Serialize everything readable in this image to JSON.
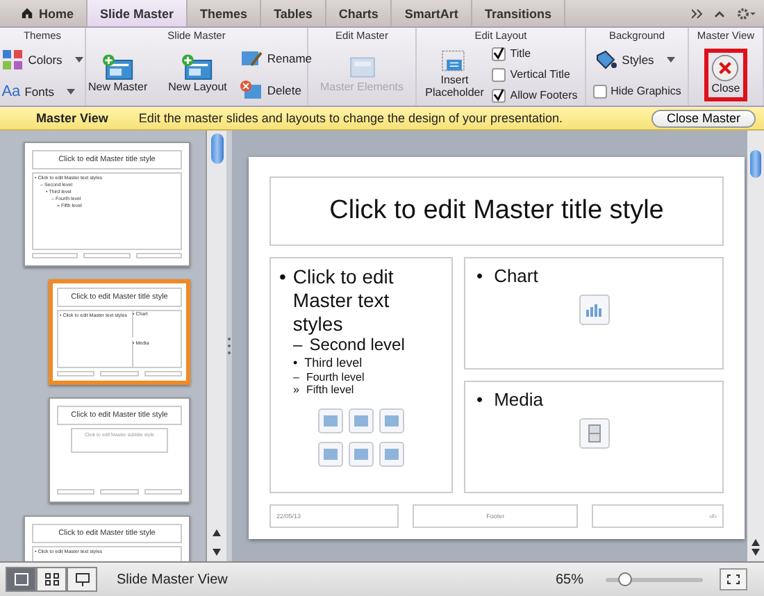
{
  "tabs": [
    {
      "label": "Home",
      "kind": "home",
      "selected": false
    },
    {
      "label": "Slide Master",
      "kind": "plain",
      "selected": true
    },
    {
      "label": "Themes",
      "kind": "plain",
      "selected": false
    },
    {
      "label": "Tables",
      "kind": "plain",
      "selected": false
    },
    {
      "label": "Charts",
      "kind": "plain",
      "selected": false
    },
    {
      "label": "SmartArt",
      "kind": "plain",
      "selected": false
    },
    {
      "label": "Transitions",
      "kind": "plain",
      "selected": false
    }
  ],
  "ribbon": [
    {
      "title": "Themes",
      "columns": [
        [
          {
            "kind": "dropdown",
            "label": "Colors"
          },
          {
            "kind": "dropdown",
            "label": "Fonts",
            "icon_text": "Aa"
          }
        ]
      ]
    },
    {
      "title": "Slide Master",
      "columns": [
        [
          {
            "kind": "large",
            "label": "New Master"
          }
        ],
        [
          {
            "kind": "large",
            "label": "New Layout"
          }
        ],
        [
          {
            "kind": "small",
            "label": "Rename"
          },
          {
            "kind": "small",
            "label": "Delete"
          }
        ]
      ]
    },
    {
      "title": "Edit Master",
      "columns": [
        [
          {
            "kind": "large",
            "label": "Master Elements",
            "disabled": true
          }
        ]
      ]
    },
    {
      "title": "Edit Layout",
      "columns": [
        [
          {
            "kind": "large",
            "label": "Insert Placeholder"
          }
        ],
        [
          {
            "kind": "check",
            "label": "Title",
            "checked": true
          },
          {
            "kind": "check",
            "label": "Vertical Title",
            "checked": false
          },
          {
            "kind": "check",
            "label": "Allow Footers",
            "checked": true
          }
        ]
      ]
    },
    {
      "title": "Background",
      "columns": [
        [
          {
            "kind": "dropdown",
            "label": "Styles"
          },
          {
            "kind": "check",
            "label": "Hide Graphics",
            "checked": false
          }
        ]
      ]
    },
    {
      "title": "Master View",
      "columns": [
        [
          {
            "kind": "large",
            "label": "Close",
            "highlighted": true
          }
        ]
      ]
    }
  ],
  "message_bar": {
    "title": "Master View",
    "text": "Edit the master slides and layouts to change the design of your presentation.",
    "button": "Close Master"
  },
  "thumbnails": [
    {
      "kind": "master",
      "selected": false,
      "title": "Click to edit Master title style",
      "body": [
        {
          "bullet": "•",
          "text": "Click to edit Master text styles",
          "children": [
            {
              "bullet": "–",
              "text": "Second level",
              "children": [
                {
                  "bullet": "•",
                  "text": "Third level",
                  "children": [
                    {
                      "bullet": "–",
                      "text": "Fourth level",
                      "children": [
                        {
                          "bullet": "»",
                          "text": "Fifth level"
                        }
                      ]
                    }
                  ]
                }
              ]
            }
          ]
        }
      ]
    },
    {
      "kind": "two",
      "selected": true,
      "title": "Click to edit Master title style",
      "body": [
        {
          "bullet": "•",
          "text": "Click to edit Master text styles"
        }
      ],
      "panes": [
        {
          "bullet": "•",
          "text": "Chart"
        },
        {
          "bullet": "•",
          "text": "Media"
        }
      ]
    },
    {
      "kind": "title",
      "selected": false,
      "title": "Click to edit Master title style",
      "subtitle": "Click to edit Master subtitle style"
    },
    {
      "kind": "master",
      "selected": false,
      "title": "Click to edit Master title style",
      "body": [
        {
          "bullet": "•",
          "text": "Click to edit Master text styles"
        }
      ]
    }
  ],
  "slide": {
    "title": "Click to edit Master title style",
    "body": [
      {
        "bullet": "•",
        "text": "Click to edit Master text styles",
        "children": [
          {
            "bullet": "–",
            "text": "Second level",
            "children": [
              {
                "bullet": "•",
                "text": "Third level",
                "children": [
                  {
                    "bullet": "–",
                    "text": "Fourth level",
                    "children": [
                      {
                        "bullet": "»",
                        "text": "Fifth level"
                      }
                    ]
                  }
                ]
              }
            ]
          }
        ]
      }
    ],
    "panes": [
      {
        "bullet": "•",
        "text": "Chart",
        "kind": "chart"
      },
      {
        "bullet": "•",
        "text": "Media",
        "kind": "media"
      }
    ],
    "footer": [
      "22/05/13",
      "Footer",
      "‹#›"
    ]
  },
  "status_bar": {
    "views": [
      {
        "selected": true
      },
      {
        "selected": false
      },
      {
        "selected": false
      }
    ],
    "text": "Slide Master View",
    "zoom": "65%",
    "zoom_slider": {
      "level": 0.2
    }
  }
}
